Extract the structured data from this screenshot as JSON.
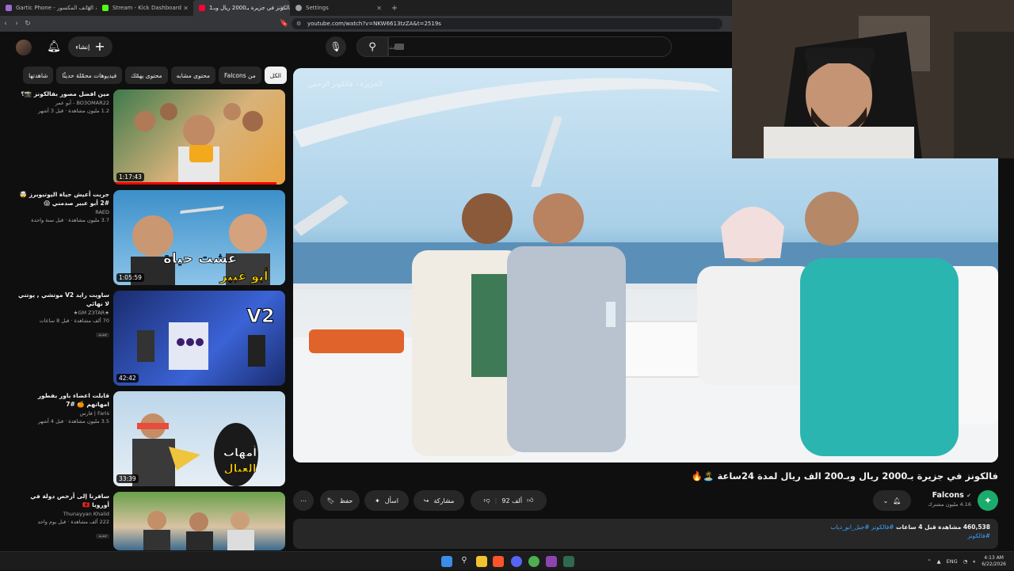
{
  "browser": {
    "tabs": [
      {
        "label": "Gartic Phone - لعبة الهاتف المكسور",
        "color": "#9b6bd6",
        "active": false
      },
      {
        "label": "Stream - Kick Dashboard",
        "color": "#53fc18",
        "active": false
      },
      {
        "label": "فالكونز في جزيرة بـ2000 ريال وبـ1...",
        "color": "#ff0033",
        "active": true
      },
      {
        "label": "Settings",
        "color": "#9aa0a6",
        "active": false
      }
    ],
    "url": "youtube.com/watch?v=NKW6613tzZA&t=2519s"
  },
  "header": {
    "create_label": "إنشاء",
    "search_placeholder": "بحث"
  },
  "chips": [
    {
      "label": "الكل",
      "selected": true
    },
    {
      "label": "من Falcons",
      "selected": false
    },
    {
      "label": "محتوى مشابه",
      "selected": false
    },
    {
      "label": "محتوى يهمّك",
      "selected": false
    },
    {
      "label": "فيديوهات محمّلة حديثًا",
      "selected": false
    },
    {
      "label": "شاهدتها",
      "selected": false
    }
  ],
  "recommendations": [
    {
      "title": "مين افضل مصور بفالكونز 📸؟",
      "channel": "BO3OMAR22 - أبو عمر",
      "meta": "1.2 مليون مشاهدة · قبل 3 أشهر",
      "badge": "",
      "duration": "1:17:43",
      "progress": 0.95,
      "thumb_colors": [
        "#3e7a4c",
        "#d8b27a",
        "#e7a33e"
      ]
    },
    {
      "title": "جربت أعيش حياة اليوتيوبرز 🤯 #2 أبو عبير صدمني 😱",
      "channel": "RAED",
      "meta": "3.7 مليون مشاهدة · قبل سنة واحدة",
      "badge": "",
      "duration": "1:05:59",
      "progress": 0,
      "thumb_colors": [
        "#3c8fc9",
        "#8cc4e9",
        "#c9a27c"
      ]
    },
    {
      "title": "ساويت رايد V2 موتشي , يوتني لا نهائي",
      "channel": "★GM Z3TAR★",
      "meta": "70 ألف مشاهدة · قبل 8 ساعات",
      "badge": "جديد",
      "duration": "42:42",
      "progress": 0,
      "thumb_colors": [
        "#1a2c6e",
        "#3b63d6",
        "#e3e8f4"
      ]
    },
    {
      "title": "قابلت اعضاء باور بفطور امهاتهم 🍊 #7",
      "channel": "Faris | فارس",
      "meta": "3.5 مليون مشاهدة · قبل 4 أشهر",
      "badge": "",
      "duration": "33:39",
      "progress": 0,
      "thumb_colors": [
        "#bcd6ea",
        "#f0c43c",
        "#2c2c2c"
      ]
    },
    {
      "title": "سافرنا إلى أرخص دولة في أوروبا 🇦🇱",
      "channel": "Thunayyan Khalid",
      "meta": "222 ألف مشاهدة · قبل يوم واحد",
      "badge": "جديد",
      "duration": "",
      "progress": 0,
      "thumb_colors": [
        "#6aa14b",
        "#d9c3a3",
        "#3c6b8f"
      ]
    }
  ],
  "player": {
    "watermark": "الجزيرة - فالكونز الرحمن"
  },
  "video": {
    "title": "فالكونز في جزيرة بـ2000 ريال وبـ200 الف ريال لمدة 24ساعة 🏝️🔥",
    "channel_name": "Falcons",
    "subscribers": "4.16 مليون مشترك",
    "likes": "92 ألف",
    "share_label": "مشاركة",
    "ask_label": "اسأل",
    "save_label": "حفظ",
    "views": "460,538 مشاهدة",
    "posted": "قبل 4 ساعات",
    "tags": "#فالكونز #جبل_ابو_ذياب",
    "hashtag": "#فالكونز"
  },
  "taskbar": {
    "lang": "ENG",
    "time": "4:13 AM",
    "date": "6/22/2026"
  }
}
